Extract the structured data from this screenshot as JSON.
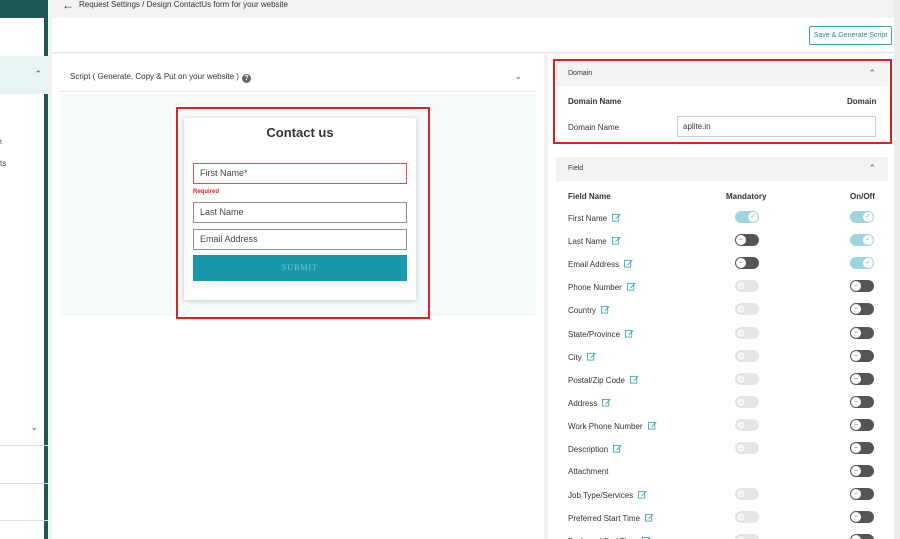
{
  "header": {
    "breadcrumb": "Request Settings  /  Design ContactUs form for your website",
    "save_button": "Save & Generate Script"
  },
  "sidebar": {
    "fragment_1": "t",
    "fragment_2": "ts"
  },
  "script_section": {
    "title": "Script ( Generate, Copy & Put on your website )"
  },
  "contact_form": {
    "title": "Contact us",
    "first_name_placeholder": "First Name*",
    "required_text": "Required",
    "last_name_placeholder": "Last Name",
    "email_placeholder": "Email Address",
    "submit_label": "SUBMIT"
  },
  "domain_section": {
    "title": "Domain",
    "col_name": "Domain Name",
    "col_value": "Domain",
    "row_label": "Domain Name",
    "row_value": "aplite.in"
  },
  "field_section": {
    "title": "Field",
    "col_name": "Field Name",
    "col_mandatory": "Mandatory",
    "col_onoff": "On/Off",
    "fields": [
      {
        "name": "First Name",
        "editable": true,
        "mandatory": "on",
        "onoff": "on"
      },
      {
        "name": "Last Name",
        "editable": true,
        "mandatory": "off",
        "onoff": "on"
      },
      {
        "name": "Email Address",
        "editable": true,
        "mandatory": "off",
        "onoff": "on"
      },
      {
        "name": "Phone Number",
        "editable": true,
        "mandatory": "disabled",
        "onoff": "off"
      },
      {
        "name": "Country",
        "editable": true,
        "mandatory": "disabled",
        "onoff": "off"
      },
      {
        "name": "State/Province",
        "editable": true,
        "mandatory": "disabled",
        "onoff": "off"
      },
      {
        "name": "City",
        "editable": true,
        "mandatory": "disabled",
        "onoff": "off"
      },
      {
        "name": "Postal/Zip Code",
        "editable": true,
        "mandatory": "disabled",
        "onoff": "off"
      },
      {
        "name": "Address",
        "editable": true,
        "mandatory": "disabled",
        "onoff": "off"
      },
      {
        "name": "Work Phone Number",
        "editable": true,
        "mandatory": "disabled",
        "onoff": "off"
      },
      {
        "name": "Description",
        "editable": true,
        "mandatory": "disabled",
        "onoff": "off"
      },
      {
        "name": "Attachment",
        "editable": false,
        "mandatory": "none",
        "onoff": "off"
      },
      {
        "name": "Job Type/Services",
        "editable": true,
        "mandatory": "disabled",
        "onoff": "off"
      },
      {
        "name": "Preferred Start Time",
        "editable": true,
        "mandatory": "disabled",
        "onoff": "off"
      },
      {
        "name": "Preferred End Time",
        "editable": true,
        "mandatory": "disabled",
        "onoff": "off"
      }
    ]
  },
  "colors": {
    "accent": "#1799aa",
    "sidebar": "#1e5a55",
    "highlight": "#e02020"
  }
}
